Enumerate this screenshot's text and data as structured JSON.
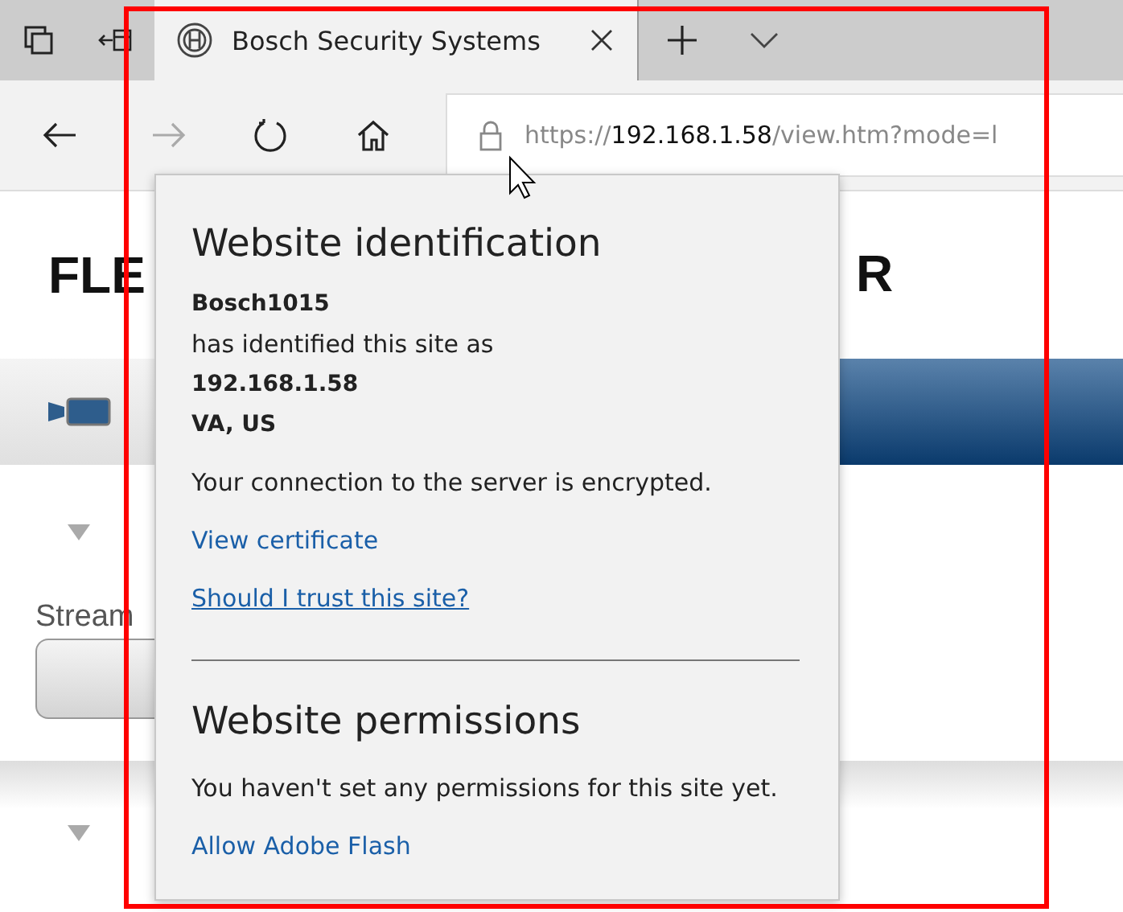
{
  "browser": {
    "tab": {
      "title": "Bosch Security Systems",
      "selected": true
    },
    "url": {
      "scheme": "https://",
      "host": "192.168.1.58",
      "path": "/view.htm?mode=l"
    }
  },
  "page": {
    "title_left": "FLE",
    "title_right": "R",
    "stream_label": "Stream"
  },
  "popup": {
    "title": "Website identification",
    "owner": "Bosch1015",
    "identified_text": "has identified this site as",
    "host": "192.168.1.58",
    "location": "VA, US",
    "connection_text": "Your connection to the server is encrypted.",
    "links": [
      {
        "text": "View certificate",
        "underlined": false
      },
      {
        "text": "Should I trust this site?",
        "underlined": true
      }
    ],
    "permissions_title": "Website permissions",
    "permissions_text": "You haven't set any permissions for this site yet.",
    "permission_links": [
      "Allow Adobe Flash"
    ]
  }
}
